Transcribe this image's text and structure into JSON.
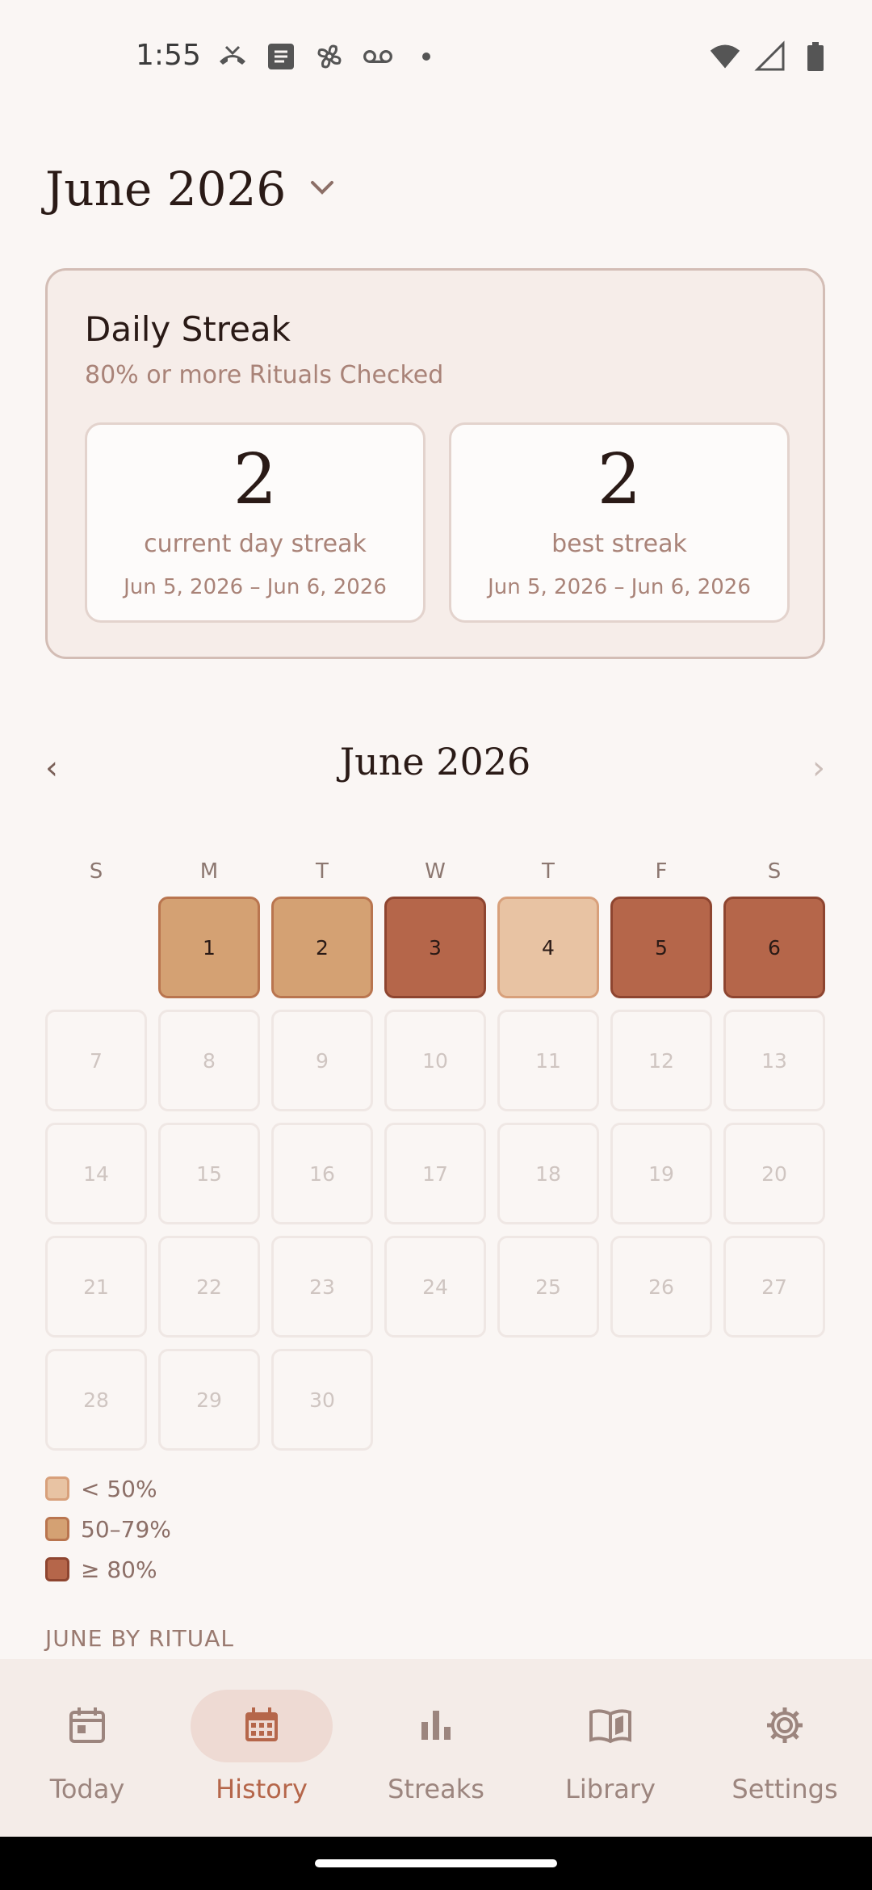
{
  "status_bar": {
    "time": "1:55",
    "left_icons": [
      "missed-call-icon",
      "tasks-icon",
      "pinwheel-icon",
      "voicemail-icon",
      "dot-icon"
    ],
    "right_icons": [
      "wifi-icon",
      "signal-icon",
      "battery-icon"
    ]
  },
  "header": {
    "month_title": "June 2026",
    "dropdown_icon": "chevron-down-icon"
  },
  "streak_card": {
    "title": "Daily Streak",
    "subtitle": "80% or more Rituals Checked",
    "current": {
      "value": "2",
      "label": "current day streak",
      "range": "Jun 5, 2026 – Jun 6, 2026"
    },
    "best": {
      "value": "2",
      "label": "best streak",
      "range": "Jun 5, 2026 – Jun 6, 2026"
    }
  },
  "calendar": {
    "title": "June 2026",
    "prev_label": "‹",
    "next_label": "›",
    "weekdays": [
      "S",
      "M",
      "T",
      "W",
      "T",
      "F",
      "S"
    ],
    "start_weekday": 1,
    "days": [
      {
        "day": "1",
        "level": "mid"
      },
      {
        "day": "2",
        "level": "mid"
      },
      {
        "day": "3",
        "level": "high"
      },
      {
        "day": "4",
        "level": "low"
      },
      {
        "day": "5",
        "level": "high"
      },
      {
        "day": "6",
        "level": "high"
      },
      {
        "day": "7",
        "level": "none"
      },
      {
        "day": "8",
        "level": "none"
      },
      {
        "day": "9",
        "level": "none"
      },
      {
        "day": "10",
        "level": "none"
      },
      {
        "day": "11",
        "level": "none"
      },
      {
        "day": "12",
        "level": "none"
      },
      {
        "day": "13",
        "level": "none"
      },
      {
        "day": "14",
        "level": "none"
      },
      {
        "day": "15",
        "level": "none"
      },
      {
        "day": "16",
        "level": "none"
      },
      {
        "day": "17",
        "level": "none"
      },
      {
        "day": "18",
        "level": "none"
      },
      {
        "day": "19",
        "level": "none"
      },
      {
        "day": "20",
        "level": "none"
      },
      {
        "day": "21",
        "level": "none"
      },
      {
        "day": "22",
        "level": "none"
      },
      {
        "day": "23",
        "level": "none"
      },
      {
        "day": "24",
        "level": "none"
      },
      {
        "day": "25",
        "level": "none"
      },
      {
        "day": "26",
        "level": "none"
      },
      {
        "day": "27",
        "level": "none"
      },
      {
        "day": "28",
        "level": "none"
      },
      {
        "day": "29",
        "level": "none"
      },
      {
        "day": "30",
        "level": "none"
      }
    ]
  },
  "legend": [
    {
      "level": "low",
      "label": "< 50%"
    },
    {
      "level": "mid",
      "label": "50–79%"
    },
    {
      "level": "high",
      "label": "≥ 80%"
    }
  ],
  "section_label": "JUNE BY RITUAL",
  "bottom_nav": [
    {
      "label": "Today",
      "icon": "calendar-icon",
      "active": false
    },
    {
      "label": "History",
      "icon": "calendar-month-icon",
      "active": true
    },
    {
      "label": "Streaks",
      "icon": "bar-chart-icon",
      "active": false
    },
    {
      "label": "Library",
      "icon": "book-icon",
      "active": false
    },
    {
      "label": "Settings",
      "icon": "gear-icon",
      "active": false
    }
  ],
  "colors": {
    "background": "#FAF6F4",
    "accent": "#B5664A",
    "low": "#E8C3A3",
    "mid": "#D4A173",
    "high": "#B5664A"
  }
}
